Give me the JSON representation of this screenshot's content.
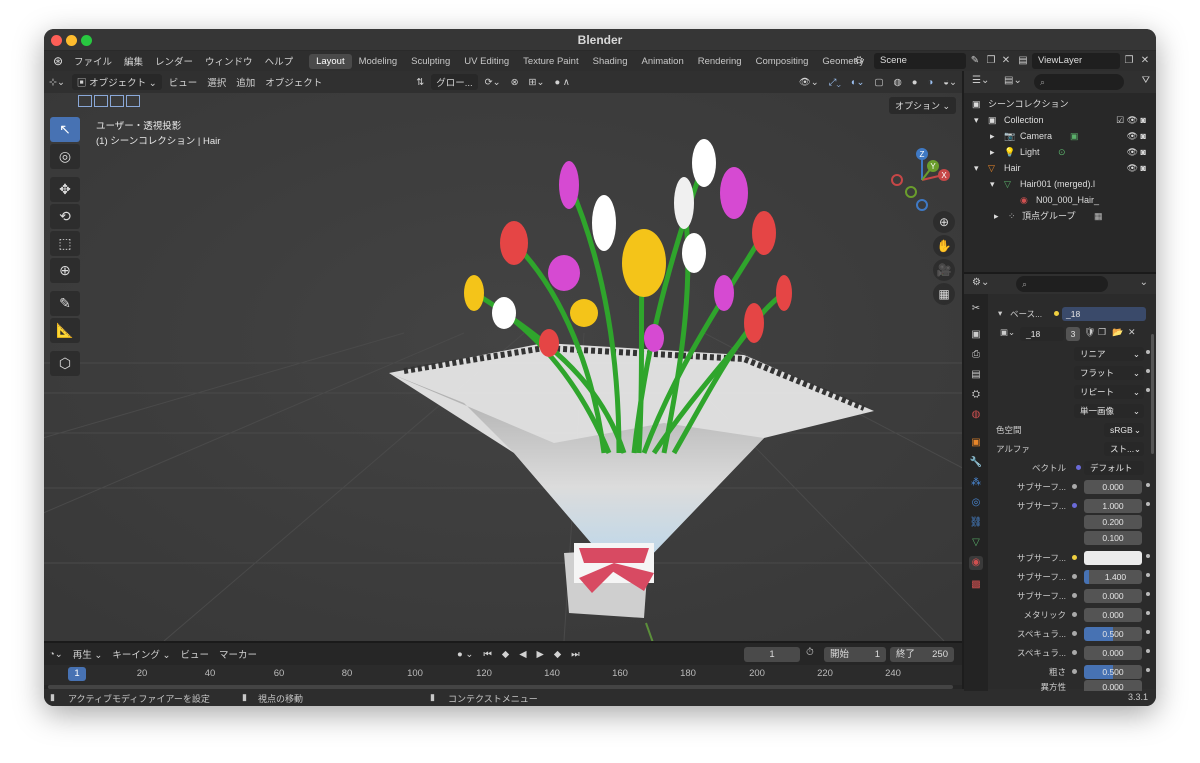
{
  "window": {
    "title": "Blender"
  },
  "topbar": {
    "menus": [
      "ファイル",
      "編集",
      "レンダー",
      "ウィンドウ",
      "ヘルプ"
    ],
    "workspaces": [
      "Layout",
      "Modeling",
      "Sculpting",
      "UV Editing",
      "Texture Paint",
      "Shading",
      "Animation",
      "Rendering",
      "Compositing",
      "Geometry"
    ],
    "active_workspace": "Layout",
    "scene": "Scene",
    "view_layer": "ViewLayer"
  },
  "viewport_header": {
    "mode": "オブジェクト",
    "menus": [
      "ビュー",
      "選択",
      "追加",
      "オブジェクト"
    ],
    "transform_orientation": "グロー..."
  },
  "viewport": {
    "view_name": "ユーザー・透視投影",
    "collection_info": "(1) シーンコレクション | Hair",
    "options_label": "オプション",
    "gizmo_labels": [
      "Z",
      "X",
      "Y"
    ]
  },
  "timeline": {
    "menus": [
      "再生",
      "キーイング",
      "ビュー",
      "マーカー"
    ],
    "current_frame": "1",
    "start_label": "開始",
    "start_value": "1",
    "end_label": "終了",
    "end_value": "250",
    "frame_indicator": "1",
    "ticks": [
      "20",
      "40",
      "60",
      "80",
      "100",
      "120",
      "140",
      "160",
      "180",
      "200",
      "220",
      "240"
    ]
  },
  "statusbar": {
    "left": "アクティブモディファイアーを設定",
    "middle": "視点の移動",
    "right": "コンテクストメニュー",
    "version": "3.3.1"
  },
  "outliner": {
    "rows": [
      {
        "label": "シーンコレクション"
      },
      {
        "label": "Collection"
      },
      {
        "label": "Camera"
      },
      {
        "label": "Light"
      },
      {
        "label": "Hair"
      },
      {
        "label": "Hair001 (merged).l"
      },
      {
        "label": "N00_000_Hair_"
      },
      {
        "label": "頂点グループ"
      }
    ]
  },
  "properties": {
    "panel_title": "ベース...",
    "panel_value": "_18",
    "image_name": "_18",
    "image_users": "3",
    "interpolation": "リニア",
    "projection": "フラット",
    "extension": "リピート",
    "source": "単一画像",
    "colorspace_label": "色空間",
    "colorspace_value": "sRGB",
    "alpha_label": "アルファ",
    "alpha_value": "スト...",
    "vector_label": "ベクトル",
    "vector_value": "デフォルト",
    "rows": [
      {
        "label": "サブサーフ...",
        "value": "0.000"
      },
      {
        "label": "サブサーフ...",
        "value": "1.000"
      },
      {
        "label": "",
        "value": "0.200"
      },
      {
        "label": "",
        "value": "0.100"
      },
      {
        "label": "サブサーフ...",
        "value": ""
      },
      {
        "label": "サブサーフ...",
        "value": "1.400"
      },
      {
        "label": "サブサーフ...",
        "value": "0.000"
      },
      {
        "label": "メタリック",
        "value": "0.000"
      },
      {
        "label": "スペキュラ...",
        "value": "0.500"
      },
      {
        "label": "スペキュラ...",
        "value": "0.000"
      },
      {
        "label": "粗さ",
        "value": "0.500"
      },
      {
        "label": "異方性",
        "value": "0.000"
      }
    ]
  },
  "colors": {
    "accent": "#4772b3",
    "active_tab": "#4a4a4a",
    "orange": "#e8862a"
  }
}
